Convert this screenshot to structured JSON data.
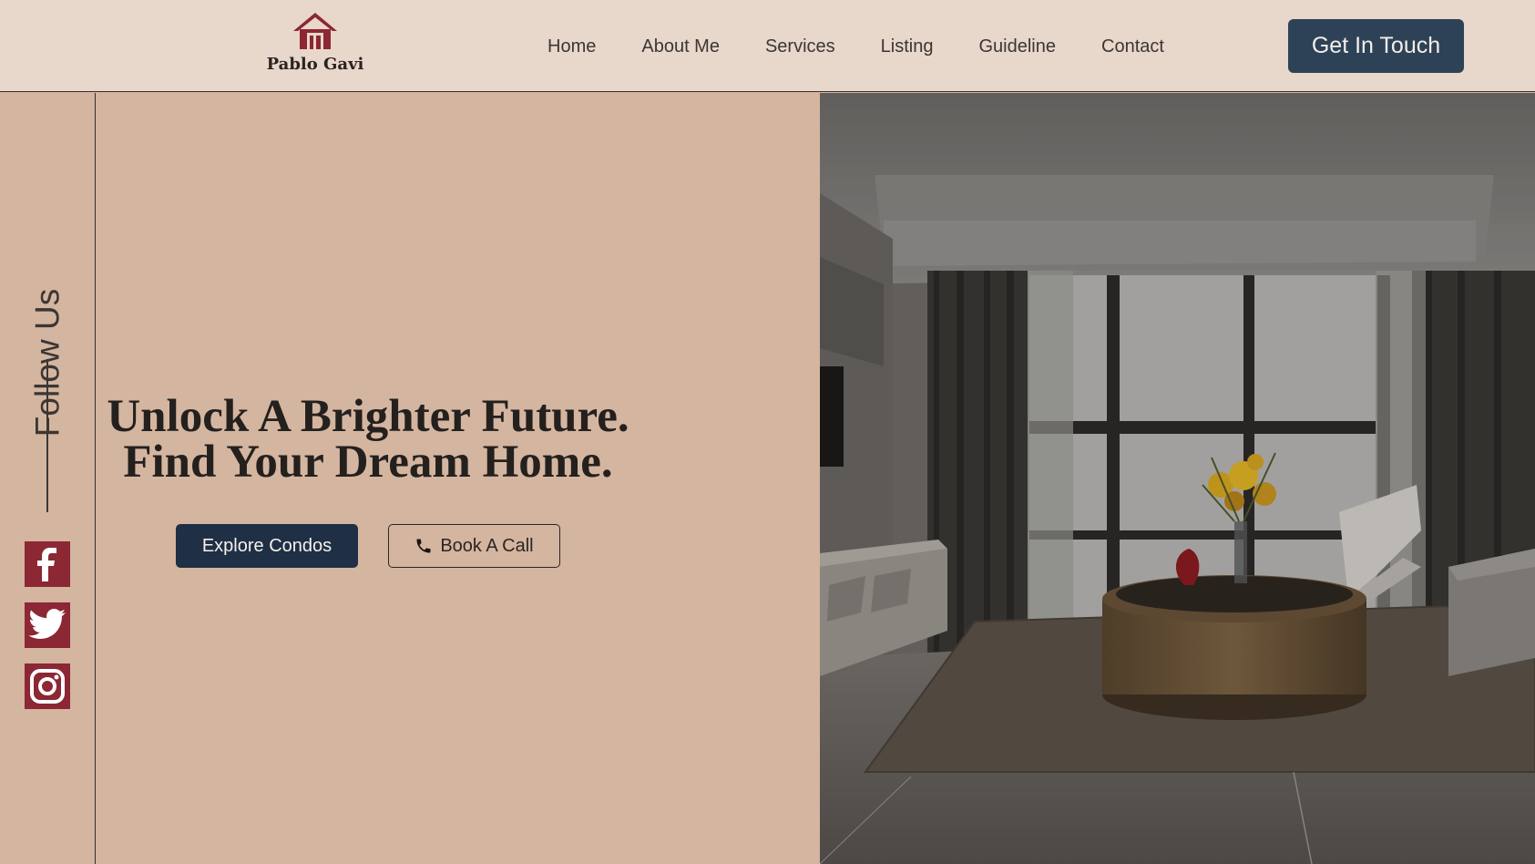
{
  "brand": {
    "name": "Pablo Gavi",
    "logo_icon": "house-icon",
    "accent": "#8c2734"
  },
  "nav": {
    "items": [
      {
        "label": "Home"
      },
      {
        "label": "About Me"
      },
      {
        "label": "Services"
      },
      {
        "label": "Listing"
      },
      {
        "label": "Guideline"
      },
      {
        "label": "Contact"
      }
    ],
    "cta_label": "Get In Touch"
  },
  "social": {
    "label": "Follow Us",
    "icons": [
      "facebook-icon",
      "twitter-icon",
      "instagram-icon"
    ]
  },
  "hero": {
    "headline_line1": "Unlock A Brighter Future.",
    "headline_line2": "Find Your Dream Home.",
    "primary_button": "Explore Condos",
    "secondary_button": "Book A Call",
    "secondary_icon": "phone-icon"
  },
  "colors": {
    "header_bg": "#e8d7cb",
    "page_bg": "#d4b5a0",
    "navy": "#1f2f45",
    "cta": "#2e4257"
  }
}
